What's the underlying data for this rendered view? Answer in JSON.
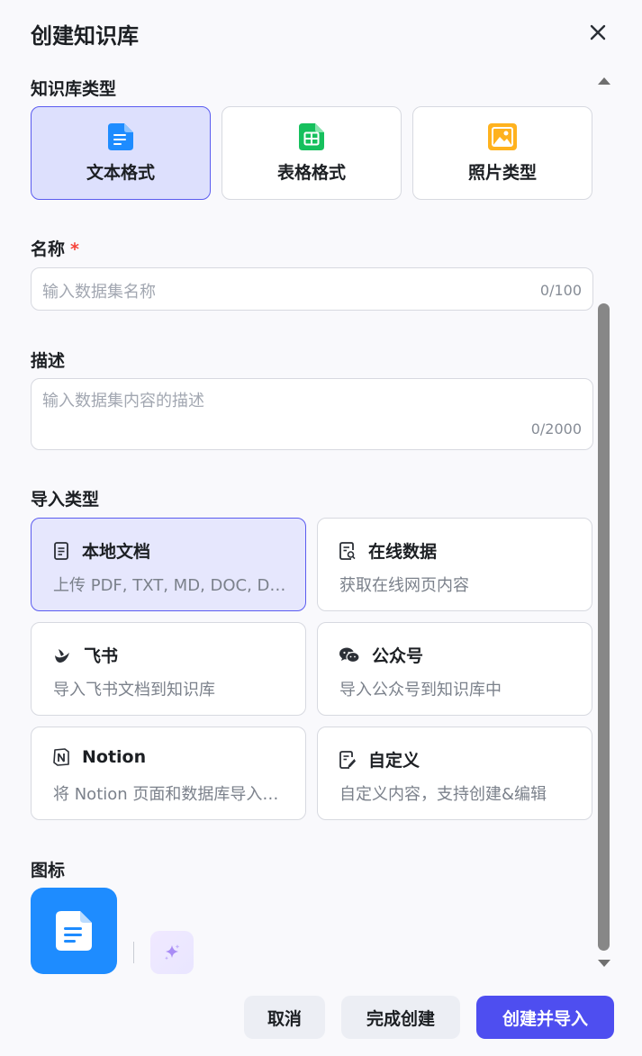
{
  "dialog": {
    "title": "创建知识库"
  },
  "kb_type": {
    "label": "知识库类型",
    "options": [
      {
        "label": "文本格式",
        "icon": "text-doc-icon",
        "selected": true
      },
      {
        "label": "表格格式",
        "icon": "table-icon",
        "selected": false
      },
      {
        "label": "照片类型",
        "icon": "image-icon",
        "selected": false
      }
    ]
  },
  "name": {
    "label": "名称",
    "required_mark": "*",
    "placeholder": "输入数据集名称",
    "counter": "0/100",
    "value": ""
  },
  "description": {
    "label": "描述",
    "placeholder": "输入数据集内容的描述",
    "counter": "0/2000",
    "value": ""
  },
  "import_type": {
    "label": "导入类型",
    "options": [
      {
        "title": "本地文档",
        "desc": "上传 PDF, TXT, MD, DOC, DOCX 格式的本地文件",
        "icon": "local-file-icon",
        "selected": true
      },
      {
        "title": "在线数据",
        "desc": "获取在线网页内容",
        "icon": "online-data-icon",
        "selected": false
      },
      {
        "title": "飞书",
        "desc": "导入飞书文档到知识库",
        "icon": "feishu-icon",
        "selected": false
      },
      {
        "title": "公众号",
        "desc": "导入公众号到知识库中",
        "icon": "wechat-icon",
        "selected": false
      },
      {
        "title": "Notion",
        "desc": "将 Notion 页面和数据库导入知识库",
        "icon": "notion-icon",
        "selected": false
      },
      {
        "title": "自定义",
        "desc": "自定义内容，支持创建&编辑",
        "icon": "custom-edit-icon",
        "selected": false
      }
    ]
  },
  "icon_section": {
    "label": "图标",
    "selected_icon": "document-icon",
    "ai_icon": "sparkle-icon"
  },
  "footer": {
    "cancel": "取消",
    "finish": "完成创建",
    "create_import": "创建并导入"
  },
  "colors": {
    "accent": "#4e4ef0",
    "selected_bg": "#dde0fd",
    "icon_tile": "#1e8cff",
    "required": "#f5433a"
  }
}
